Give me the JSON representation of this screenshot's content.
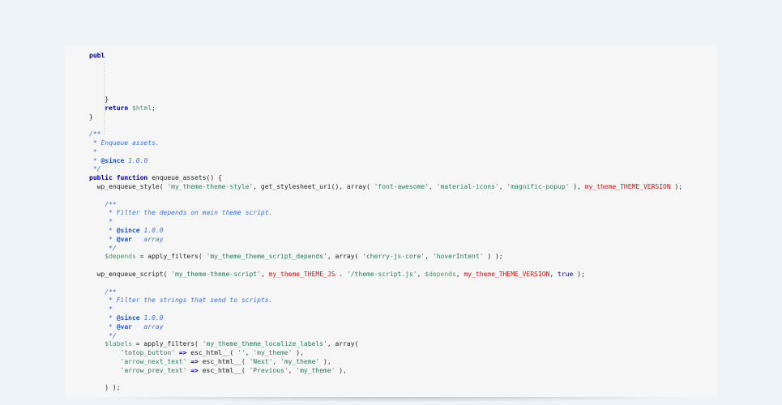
{
  "code_lines": [
    [
      {
        "t": "publ",
        "c": "kw"
      }
    ],
    [],
    [],
    [],
    [],
    [
      {
        "t": "    }",
        "c": "fn"
      }
    ],
    [
      {
        "t": "    ",
        "c": "fn"
      },
      {
        "t": "return",
        "c": "kw"
      },
      {
        "t": " ",
        "c": "fn"
      },
      {
        "t": "$html",
        "c": "var"
      },
      {
        "t": ";",
        "c": "fn"
      }
    ],
    [
      {
        "t": "}",
        "c": "fn"
      }
    ],
    [],
    [
      {
        "t": "/**",
        "c": "cmt"
      }
    ],
    [
      {
        "t": " * Enqueue assets.",
        "c": "cmt"
      }
    ],
    [
      {
        "t": " *",
        "c": "cmt"
      }
    ],
    [
      {
        "t": " * ",
        "c": "cmt"
      },
      {
        "t": "@since",
        "c": "tag"
      },
      {
        "t": " 1.0.0",
        "c": "cmt"
      }
    ],
    [
      {
        "t": " */",
        "c": "cmt"
      }
    ],
    [
      {
        "t": "public function",
        "c": "kw"
      },
      {
        "t": " enqueue_assets() {",
        "c": "fn"
      }
    ],
    [
      {
        "t": "  wp_enqueue_style( ",
        "c": "fn"
      },
      {
        "t": "'my_theme-theme-style'",
        "c": "str"
      },
      {
        "t": ", get_stylesheet_uri(), array( ",
        "c": "fn"
      },
      {
        "t": "'font-awesome'",
        "c": "str"
      },
      {
        "t": ", ",
        "c": "fn"
      },
      {
        "t": "'material-icons'",
        "c": "str"
      },
      {
        "t": ", ",
        "c": "fn"
      },
      {
        "t": "'magnific-popup'",
        "c": "str"
      },
      {
        "t": " ), ",
        "c": "fn"
      },
      {
        "t": "my_theme_THEME_VERSION",
        "c": "const"
      },
      {
        "t": " );",
        "c": "fn"
      }
    ],
    [],
    [
      {
        "t": "    /**",
        "c": "cmt"
      }
    ],
    [
      {
        "t": "     * Filter the depends on main theme script.",
        "c": "cmt"
      }
    ],
    [
      {
        "t": "     *",
        "c": "cmt"
      }
    ],
    [
      {
        "t": "     * ",
        "c": "cmt"
      },
      {
        "t": "@since",
        "c": "tag"
      },
      {
        "t": " 1.0.0",
        "c": "cmt"
      }
    ],
    [
      {
        "t": "     * ",
        "c": "cmt"
      },
      {
        "t": "@var",
        "c": "tag"
      },
      {
        "t": "   array",
        "c": "cmt"
      }
    ],
    [
      {
        "t": "     */",
        "c": "cmt"
      }
    ],
    [
      {
        "t": "    ",
        "c": "fn"
      },
      {
        "t": "$depends",
        "c": "var"
      },
      {
        "t": " = apply_filters( ",
        "c": "fn"
      },
      {
        "t": "'my_theme_theme_script_depends'",
        "c": "str"
      },
      {
        "t": ", array( ",
        "c": "fn"
      },
      {
        "t": "'cherry-js-core'",
        "c": "str"
      },
      {
        "t": ", ",
        "c": "fn"
      },
      {
        "t": "'hoverIntent'",
        "c": "str"
      },
      {
        "t": " ) );",
        "c": "fn"
      }
    ],
    [],
    [
      {
        "t": "  wp_enqueue_script( ",
        "c": "fn"
      },
      {
        "t": "'my_theme-theme-script'",
        "c": "str"
      },
      {
        "t": ", ",
        "c": "fn"
      },
      {
        "t": "my_theme_THEME_JS",
        "c": "const"
      },
      {
        "t": " . ",
        "c": "fn"
      },
      {
        "t": "'/theme-script.js'",
        "c": "str"
      },
      {
        "t": ", ",
        "c": "fn"
      },
      {
        "t": "$depends",
        "c": "var"
      },
      {
        "t": ", ",
        "c": "fn"
      },
      {
        "t": "my_theme_THEME_VERSION",
        "c": "const"
      },
      {
        "t": ", ",
        "c": "fn"
      },
      {
        "t": "true",
        "c": "bool"
      },
      {
        "t": " );",
        "c": "fn"
      }
    ],
    [],
    [
      {
        "t": "    /**",
        "c": "cmt"
      }
    ],
    [
      {
        "t": "     * Filter the strings that send to scripts.",
        "c": "cmt"
      }
    ],
    [
      {
        "t": "     *",
        "c": "cmt"
      }
    ],
    [
      {
        "t": "     * ",
        "c": "cmt"
      },
      {
        "t": "@since",
        "c": "tag"
      },
      {
        "t": " 1.0.0",
        "c": "cmt"
      }
    ],
    [
      {
        "t": "     * ",
        "c": "cmt"
      },
      {
        "t": "@var",
        "c": "tag"
      },
      {
        "t": "   array",
        "c": "cmt"
      }
    ],
    [
      {
        "t": "     */",
        "c": "cmt"
      }
    ],
    [
      {
        "t": "    ",
        "c": "fn"
      },
      {
        "t": "$labels",
        "c": "var"
      },
      {
        "t": " = apply_filters( ",
        "c": "fn"
      },
      {
        "t": "'my_theme_theme_localize_labels'",
        "c": "str"
      },
      {
        "t": ", array(",
        "c": "fn"
      }
    ],
    [
      {
        "t": "        ",
        "c": "fn"
      },
      {
        "t": "'totop_button'",
        "c": "str"
      },
      {
        "t": " => ",
        "c": "kw"
      },
      {
        "t": "esc_html__( ",
        "c": "fn"
      },
      {
        "t": "''",
        "c": "str"
      },
      {
        "t": ", ",
        "c": "fn"
      },
      {
        "t": "'my_theme'",
        "c": "str"
      },
      {
        "t": " ),",
        "c": "fn"
      }
    ],
    [
      {
        "t": "        ",
        "c": "fn"
      },
      {
        "t": "'arrow_next_text'",
        "c": "str"
      },
      {
        "t": " => ",
        "c": "kw"
      },
      {
        "t": "esc_html__( ",
        "c": "fn"
      },
      {
        "t": "'Next'",
        "c": "str"
      },
      {
        "t": ", ",
        "c": "fn"
      },
      {
        "t": "'my_theme'",
        "c": "str"
      },
      {
        "t": " ),",
        "c": "fn"
      }
    ],
    [
      {
        "t": "        ",
        "c": "fn"
      },
      {
        "t": "'arrow_prev_text'",
        "c": "str"
      },
      {
        "t": " => ",
        "c": "kw"
      },
      {
        "t": "esc_html__( ",
        "c": "fn"
      },
      {
        "t": "'Previous'",
        "c": "str"
      },
      {
        "t": ", ",
        "c": "fn"
      },
      {
        "t": "'my_theme'",
        "c": "str"
      },
      {
        "t": " ),",
        "c": "fn"
      }
    ],
    [],
    [
      {
        "t": "    ) );",
        "c": "fn"
      }
    ]
  ]
}
